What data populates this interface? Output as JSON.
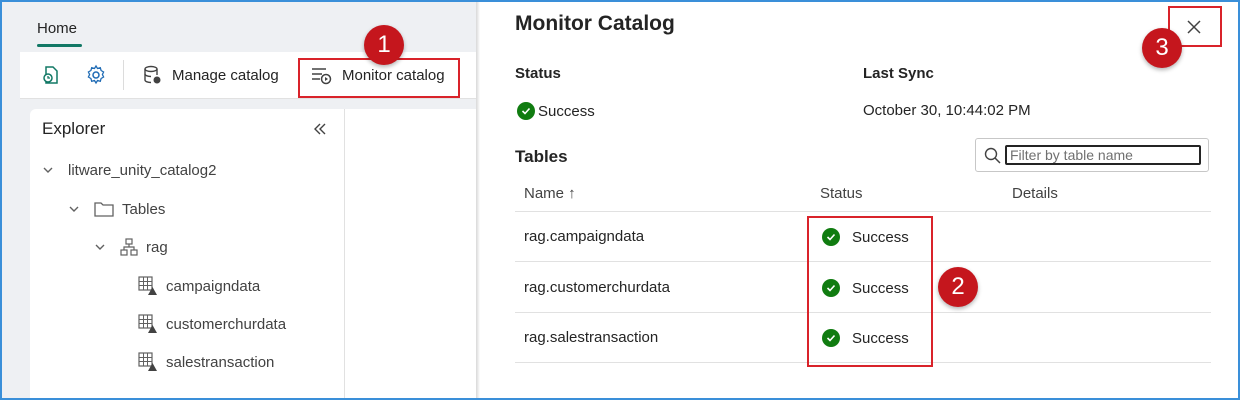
{
  "ribbon": {
    "home_tab": "Home",
    "manage_catalog_label": "Manage catalog",
    "monitor_catalog_label": "Monitor catalog"
  },
  "explorer": {
    "title": "Explorer",
    "tree": [
      {
        "label": "litware_unity_catalog2",
        "type": "catalog"
      },
      {
        "label": "Tables",
        "type": "folder"
      },
      {
        "label": "rag",
        "type": "schema"
      },
      {
        "label": "campaigndata",
        "type": "table"
      },
      {
        "label": "customerchurdata",
        "type": "table"
      },
      {
        "label": "salestransaction",
        "type": "table"
      }
    ]
  },
  "panel": {
    "title": "Monitor Catalog",
    "status_label": "Status",
    "status_value": "Success",
    "last_sync_label": "Last Sync",
    "last_sync_value": "October 30, 10:44:02 PM",
    "tables_label": "Tables",
    "filter_placeholder": "Filter by table name",
    "columns": {
      "name": "Name ↑",
      "status": "Status",
      "details": "Details"
    },
    "rows": [
      {
        "name": "rag.campaigndata",
        "status": "Success",
        "details": ""
      },
      {
        "name": "rag.customerchurdata",
        "status": "Success",
        "details": ""
      },
      {
        "name": "rag.salestransaction",
        "status": "Success",
        "details": ""
      }
    ]
  },
  "callouts": [
    "1",
    "2",
    "3"
  ],
  "colors": {
    "accent": "#117865",
    "success": "#107c10",
    "callout": "#c5161d",
    "highlight": "#d9232a",
    "frame": "#3a8fd9"
  },
  "icons": {
    "refresh": "refresh-icon",
    "settings": "gear-icon",
    "manage": "database-icon",
    "monitor": "monitor-list-icon",
    "close": "close-icon",
    "collapse": "double-chevron-left-icon",
    "search": "search-icon",
    "success": "check-circle-icon"
  }
}
